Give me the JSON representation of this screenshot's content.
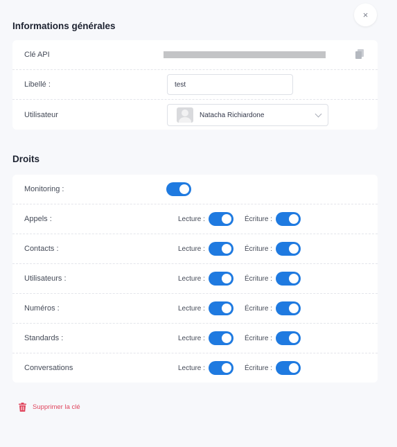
{
  "close": {
    "glyph": "×"
  },
  "general": {
    "title": "Informations générales",
    "api_key_label": "Clé API",
    "label_label": "Libellé :",
    "label_value": "test",
    "user_label": "Utilisateur",
    "user_value": "Natacha Richiardone"
  },
  "rights": {
    "title": "Droits",
    "monitoring_label": "Monitoring :",
    "monitoring_on": true,
    "read_label": "Lecture :",
    "write_label": "Écriture :",
    "rows": [
      {
        "label": "Appels :",
        "read": true,
        "write": true
      },
      {
        "label": "Contacts :",
        "read": true,
        "write": true
      },
      {
        "label": "Utilisateurs :",
        "read": true,
        "write": true
      },
      {
        "label": "Numéros :",
        "read": true,
        "write": true
      },
      {
        "label": "Standards :",
        "read": true,
        "write": true
      },
      {
        "label": "Conversations",
        "read": true,
        "write": true
      }
    ]
  },
  "delete": {
    "label": "Supprimer la clé"
  },
  "colors": {
    "accent": "#1f7ae0",
    "danger": "#e0465e"
  }
}
